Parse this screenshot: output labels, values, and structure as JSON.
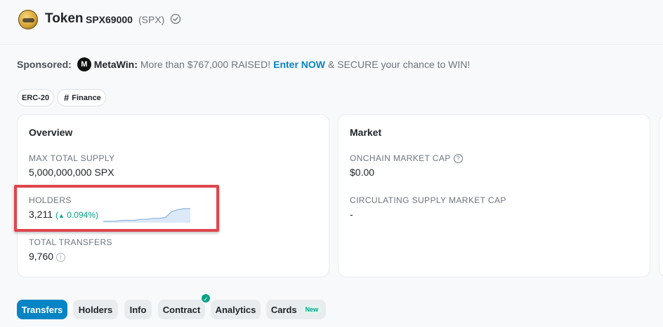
{
  "header": {
    "title": "Token",
    "token_name": "SPX69000",
    "token_symbol": "(SPX)",
    "logo_icon": "token-logo",
    "verified_icon": "check-circle-icon"
  },
  "sponsor": {
    "label": "Sponsored:",
    "brand_icon_text": "M",
    "brand": "MetaWin:",
    "text": "More than $767,000 RAISED!",
    "cta": "Enter NOW",
    "text2": "& SECURE your chance to WIN!",
    "cta_color": "#0784c3"
  },
  "tags": [
    {
      "label": "ERC-20"
    },
    {
      "label": "Finance",
      "icon": "hash-icon"
    }
  ],
  "overview": {
    "title": "Overview",
    "max_supply_label": "MAX TOTAL SUPPLY",
    "max_supply_value": "5,000,000,000 SPX",
    "holders_label": "HOLDERS",
    "holders_value": "3,211",
    "holders_change": "0.094%",
    "holders_change_color": "#00a186",
    "holders_sparkline": [
      10,
      10,
      10,
      11,
      11,
      11,
      12,
      12,
      13,
      13,
      14,
      20,
      22,
      23,
      23
    ],
    "transfers_label": "TOTAL TRANSFERS",
    "transfers_value": "9,760"
  },
  "market": {
    "title": "Market",
    "onchain_cap_label": "ONCHAIN MARKET CAP",
    "onchain_cap_value": "$0.00",
    "circ_cap_label": "CIRCULATING SUPPLY MARKET CAP",
    "circ_cap_value": "-"
  },
  "tabs": [
    {
      "label": "Transfers",
      "active": true
    },
    {
      "label": "Holders"
    },
    {
      "label": "Info"
    },
    {
      "label": "Contract",
      "badge": "check-icon"
    },
    {
      "label": "Analytics"
    },
    {
      "label": "Cards",
      "badge_text": "New"
    }
  ],
  "accent_color": "#0784c3",
  "highlight_color": "#e0454c"
}
